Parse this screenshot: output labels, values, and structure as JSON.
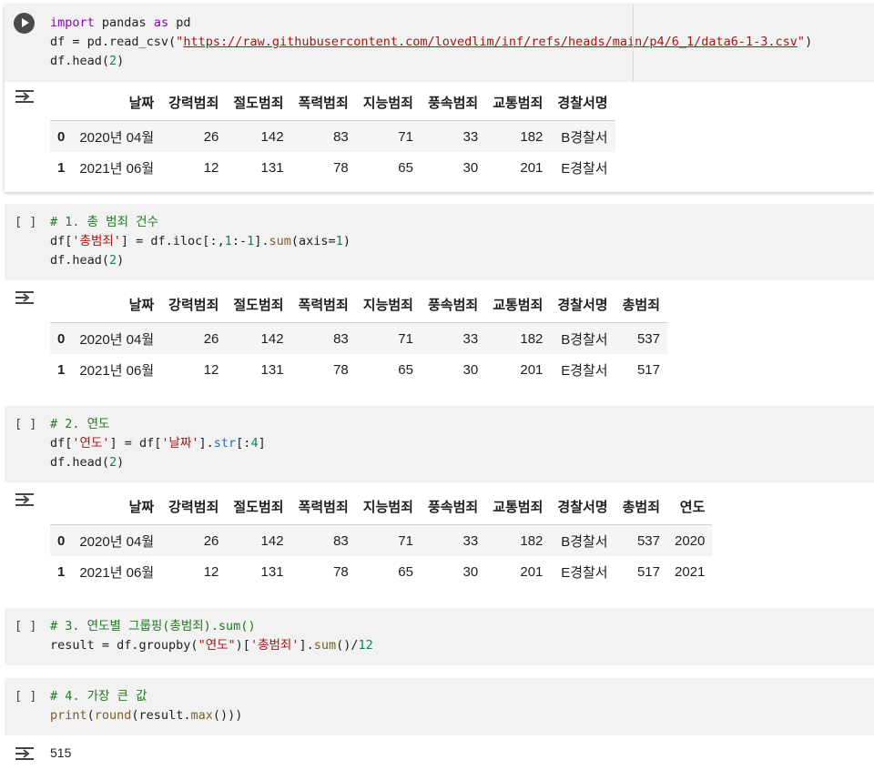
{
  "cells": [
    {
      "kind": "run",
      "code_lines": [
        [
          {
            "t": "import",
            "c": "kw"
          },
          {
            "t": " pandas "
          },
          {
            "t": "as",
            "c": "kw"
          },
          {
            "t": " pd"
          }
        ],
        [
          {
            "t": "df = pd.read_csv("
          },
          {
            "t": "\"",
            "c": "str"
          },
          {
            "t": "https://raw.githubusercontent.com/lovedlim/inf/refs/heads/main/p4/6_1/data6-1-3.csv",
            "c": "url"
          },
          {
            "t": "\"",
            "c": "str"
          },
          {
            "t": ")"
          }
        ],
        [
          {
            "t": "df.head("
          },
          {
            "t": "2",
            "c": "num"
          },
          {
            "t": ")"
          }
        ]
      ],
      "table": {
        "columns": [
          "날짜",
          "강력범죄",
          "절도범죄",
          "폭력범죄",
          "지능범죄",
          "풍속범죄",
          "교통범죄",
          "경찰서명"
        ],
        "rows": [
          {
            "index": "0",
            "values": [
              "2020년 04월",
              "26",
              "142",
              "83",
              "71",
              "33",
              "182",
              "B경찰서"
            ]
          },
          {
            "index": "1",
            "values": [
              "2021년 06월",
              "12",
              "131",
              "78",
              "65",
              "30",
              "201",
              "E경찰서"
            ]
          }
        ]
      }
    },
    {
      "kind": "bracket",
      "bracket": "[ ]",
      "code_lines": [
        [
          {
            "t": "# 1. 총 범죄 건수",
            "c": "cm"
          }
        ],
        [
          {
            "t": "df["
          },
          {
            "t": "'총범죄'",
            "c": "str"
          },
          {
            "t": "] = df.iloc[:,"
          },
          {
            "t": "1",
            "c": "num"
          },
          {
            "t": ":-"
          },
          {
            "t": "1",
            "c": "num"
          },
          {
            "t": "]."
          },
          {
            "t": "sum",
            "c": "fn"
          },
          {
            "t": "(axis="
          },
          {
            "t": "1",
            "c": "num"
          },
          {
            "t": ")"
          }
        ],
        [
          {
            "t": "df.head("
          },
          {
            "t": "2",
            "c": "num"
          },
          {
            "t": ")"
          }
        ]
      ],
      "table": {
        "columns": [
          "날짜",
          "강력범죄",
          "절도범죄",
          "폭력범죄",
          "지능범죄",
          "풍속범죄",
          "교통범죄",
          "경찰서명",
          "총범죄"
        ],
        "rows": [
          {
            "index": "0",
            "values": [
              "2020년 04월",
              "26",
              "142",
              "83",
              "71",
              "33",
              "182",
              "B경찰서",
              "537"
            ]
          },
          {
            "index": "1",
            "values": [
              "2021년 06월",
              "12",
              "131",
              "78",
              "65",
              "30",
              "201",
              "E경찰서",
              "517"
            ]
          }
        ]
      }
    },
    {
      "kind": "bracket",
      "bracket": "[ ]",
      "code_lines": [
        [
          {
            "t": "# 2. 연도",
            "c": "cm"
          }
        ],
        [
          {
            "t": "df["
          },
          {
            "t": "'연도'",
            "c": "str"
          },
          {
            "t": "] = df["
          },
          {
            "t": "'날짜'",
            "c": "str"
          },
          {
            "t": "]."
          },
          {
            "t": "str",
            "c": "at"
          },
          {
            "t": "[:"
          },
          {
            "t": "4",
            "c": "num"
          },
          {
            "t": "]"
          }
        ],
        [
          {
            "t": "df.head("
          },
          {
            "t": "2",
            "c": "num"
          },
          {
            "t": ")"
          }
        ]
      ],
      "table": {
        "columns": [
          "날짜",
          "강력범죄",
          "절도범죄",
          "폭력범죄",
          "지능범죄",
          "풍속범죄",
          "교통범죄",
          "경찰서명",
          "총범죄",
          "연도"
        ],
        "rows": [
          {
            "index": "0",
            "values": [
              "2020년 04월",
              "26",
              "142",
              "83",
              "71",
              "33",
              "182",
              "B경찰서",
              "537",
              "2020"
            ]
          },
          {
            "index": "1",
            "values": [
              "2021년 06월",
              "12",
              "131",
              "78",
              "65",
              "30",
              "201",
              "E경찰서",
              "517",
              "2021"
            ]
          }
        ]
      }
    },
    {
      "kind": "bracket",
      "bracket": "[ ]",
      "code_lines": [
        [
          {
            "t": "# 3. 연도별 그룹핑(총범죄).sum()",
            "c": "cm"
          }
        ],
        [
          {
            "t": "result = df.groupby("
          },
          {
            "t": "\"연도\"",
            "c": "str"
          },
          {
            "t": ")["
          },
          {
            "t": "'총범죄'",
            "c": "str"
          },
          {
            "t": "]."
          },
          {
            "t": "sum",
            "c": "fn"
          },
          {
            "t": "()/"
          },
          {
            "t": "12",
            "c": "num"
          }
        ]
      ]
    },
    {
      "kind": "bracket",
      "bracket": "[ ]",
      "code_lines": [
        [
          {
            "t": "# 4. 가장 큰 값",
            "c": "cm"
          }
        ],
        [
          {
            "t": "print",
            "c": "fn"
          },
          {
            "t": "("
          },
          {
            "t": "round",
            "c": "fn"
          },
          {
            "t": "(result."
          },
          {
            "t": "max",
            "c": "fn"
          },
          {
            "t": "()))"
          }
        ]
      ],
      "output_text": "515"
    }
  ],
  "colors": {
    "code_bg": "#f2f2f2",
    "keyword": "#8f00b5",
    "string": "#a31515",
    "comment": "#1f7a1f",
    "number": "#098658"
  },
  "icons": {
    "run": "run-cell-icon",
    "output": "output-toggle-icon"
  }
}
